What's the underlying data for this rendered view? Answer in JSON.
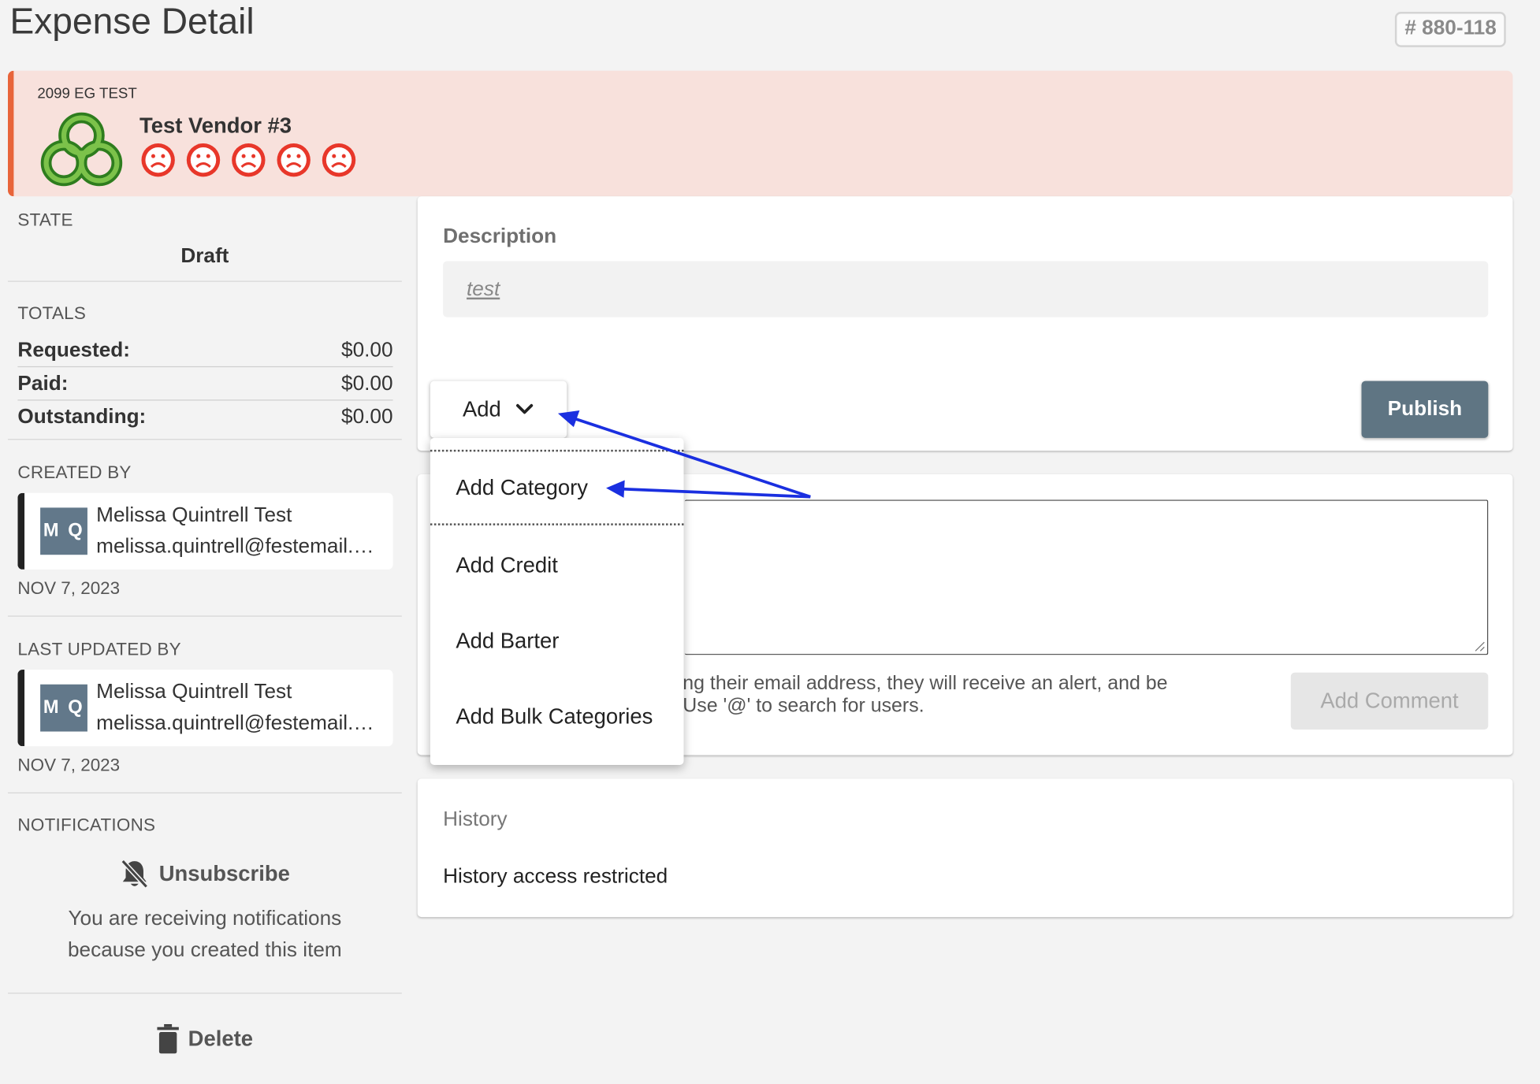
{
  "header": {
    "title": "Expense Detail",
    "id_badge": "# 880-118"
  },
  "vendor": {
    "org": "2099 EG TEST",
    "name": "Test Vendor #3",
    "rating_faces": 5,
    "logo_icon": "green-triple-ring-logo",
    "banner_color": "#f8e1dc",
    "accent_color": "#e8643a"
  },
  "sidebar": {
    "state_label": "STATE",
    "state_value": "Draft",
    "totals_label": "TOTALS",
    "totals": [
      {
        "label": "Requested:",
        "value": "$0.00"
      },
      {
        "label": "Paid:",
        "value": "$0.00"
      },
      {
        "label": "Outstanding:",
        "value": "$0.00"
      }
    ],
    "created_by_label": "CREATED BY",
    "created_by": {
      "initials": "M Q",
      "name": "Melissa Quintrell Test",
      "email": "melissa.quintrell@festemail.com",
      "date": "NOV 7, 2023"
    },
    "updated_by_label": "LAST UPDATED BY",
    "updated_by": {
      "initials": "M Q",
      "name": "Melissa Quintrell Test",
      "email": "melissa.quintrell@festemail.com",
      "date": "NOV 7, 2023"
    },
    "notifications_label": "NOTIFICATIONS",
    "unsubscribe_label": "Unsubscribe",
    "notif_line1": "You are receiving notifications",
    "notif_line2": "because you created this item",
    "delete_label": "Delete"
  },
  "main": {
    "description_label": "Description",
    "description_value": "test",
    "add_label": "Add",
    "publish_label": "Publish",
    "hint_line1": "ng their email address, they will receive an alert, and be",
    "hint_line2": " Use '@' to search for users.",
    "add_comment_label": "Add Comment",
    "history_label": "History",
    "history_text": "History access restricted",
    "publish_color": "#5f7583"
  },
  "dropdown": {
    "items": [
      "Add Category",
      "Add Credit",
      "Add Barter",
      "Add Bulk Categories"
    ]
  },
  "annotation_color": "#1a2fe0"
}
